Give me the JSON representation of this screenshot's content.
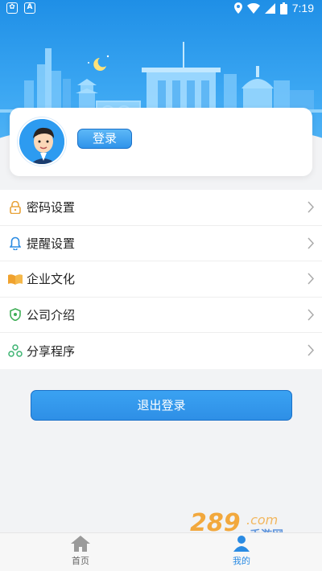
{
  "status_bar": {
    "time": "7:19",
    "left_icons": [
      "app-icon",
      "a-icon"
    ],
    "right_icons": [
      "location-icon",
      "wifi-icon",
      "signal-icon",
      "battery-icon"
    ]
  },
  "profile": {
    "login_label": "登录"
  },
  "menu": {
    "items": [
      {
        "label": "密码设置",
        "icon": "lock-icon"
      },
      {
        "label": "提醒设置",
        "icon": "bell-icon"
      },
      {
        "label": "企业文化",
        "icon": "book-icon"
      },
      {
        "label": "公司介绍",
        "icon": "shield-icon"
      },
      {
        "label": "分享程序",
        "icon": "share-icon"
      }
    ]
  },
  "logout_label": "退出登录",
  "bottom_nav": {
    "tabs": [
      {
        "label": "首页",
        "icon": "home-icon",
        "active": false
      },
      {
        "label": "我的",
        "icon": "user-icon",
        "active": true
      }
    ]
  },
  "watermark": {
    "text_main": "289",
    "text_sub": "手游网",
    "text_com": ".com"
  },
  "colors": {
    "primary": "#2e8fe6",
    "header_top": "#1f8fe6",
    "background": "#f2f3f5",
    "text": "#222222"
  }
}
